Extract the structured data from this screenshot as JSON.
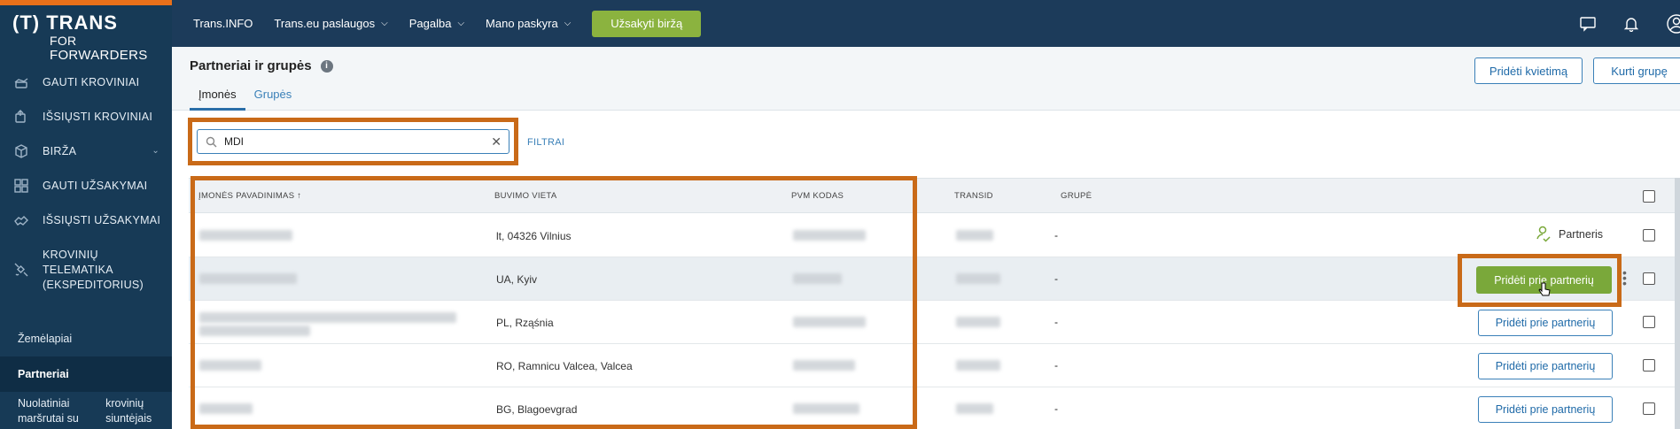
{
  "brand": {
    "logo_line1": "(T) TRANS",
    "logo_line2_small": "FOR",
    "logo_line2_big": "FORWARDERS",
    "accent_color": "#e8701a",
    "sidebar_color": "#173a56"
  },
  "sidebar": {
    "items": [
      {
        "label": "GAUTI KROVINIAI",
        "icon": "box-in-icon"
      },
      {
        "label": "IŠSIŲSTI KROVINIAI",
        "icon": "box-out-icon"
      },
      {
        "label": "BIRŽA",
        "icon": "cube-icon"
      },
      {
        "label": "GAUTI UŽSAKYMAI",
        "icon": "grid-icon"
      },
      {
        "label": "IŠSIŲSTI UŽSAKYMAI",
        "icon": "handshake-icon"
      },
      {
        "label": "KROVINIŲ TELEMATIKA (EKSPEDITORIUS)",
        "line1": "KROVINIŲ",
        "line2": "TELEMATIKA",
        "line3": "(EKSPEDITORIUS)",
        "icon": "satellite-icon"
      }
    ],
    "sub_items": [
      {
        "label": "Žemėlapiai"
      },
      {
        "label": "Partneriai"
      },
      {
        "label_line1": "Nuolatiniai maršrutai su",
        "label_line2": "krovinių siuntėjais"
      }
    ]
  },
  "topbar": {
    "links": [
      "Trans.INFO",
      "Trans.eu paslaugos",
      "Pagalba",
      "Mano paskyra"
    ],
    "order_button": "Užsakyti biržą"
  },
  "header": {
    "title": "Partneriai ir grupės",
    "tabs": [
      "Įmonės",
      "Grupės"
    ],
    "invite_button": "Pridėti kvietimą",
    "create_group_button": "Kurti grupę"
  },
  "search": {
    "value": "MDI",
    "filters_label": "FILTRAI"
  },
  "table": {
    "columns": [
      "ĮMONĖS PAVADINIMAS ↑",
      "BUVIMO VIETA",
      "PVM KODAS",
      "TRANSID",
      "GRUPĖ"
    ],
    "rows": [
      {
        "location": "lt, 04326 Vilnius",
        "group": "-",
        "status": "partner"
      },
      {
        "location": "UA, Kyiv",
        "group": "-",
        "status": "highlight"
      },
      {
        "location": "PL, Rząśnia",
        "group": "-",
        "status": "add"
      },
      {
        "location": "RO, Ramnicu Valcea, Valcea",
        "group": "-",
        "status": "add"
      },
      {
        "location": "BG, Blagoevgrad",
        "group": "-",
        "status": "add"
      }
    ],
    "partner_label": "Partneris",
    "add_partner_label": "Pridėti prie partnerių"
  }
}
